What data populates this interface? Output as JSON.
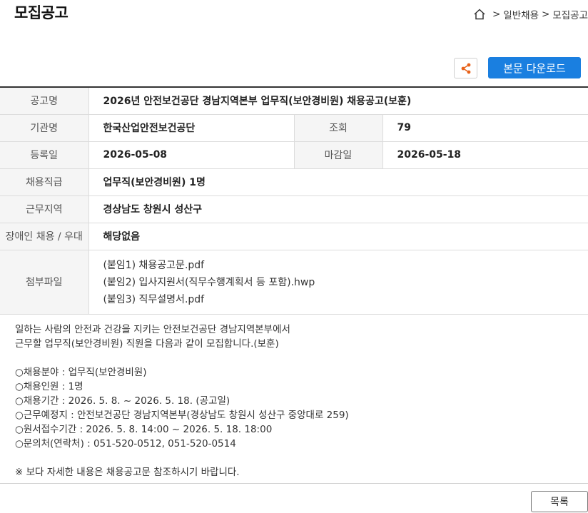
{
  "header": {
    "title": "모집공고",
    "breadcrumb": [
      ">",
      "일반채용",
      ">",
      "모집공고"
    ]
  },
  "toolbar": {
    "share_icon": "share-icon",
    "download_label": "본문 다운로드"
  },
  "info": {
    "rows": {
      "title": {
        "label": "공고명",
        "value": "2026년 안전보건공단 경남지역본부 업무직(보안경비원) 채용공고(보훈)"
      },
      "org": {
        "label": "기관명",
        "value": "한국산업안전보건공단"
      },
      "views": {
        "label": "조회",
        "value": "79"
      },
      "reg_date": {
        "label": "등록일",
        "value": "2026-05-08"
      },
      "deadline": {
        "label": "마감일",
        "value": "2026-05-18"
      },
      "position": {
        "label": "채용직급",
        "value": "업무직(보안경비원) 1명"
      },
      "region": {
        "label": "근무지역",
        "value": "경상남도 창원시 성산구"
      },
      "disability": {
        "label": "장애인 채용 / 우대",
        "value": "해당없음"
      },
      "attachments": {
        "label": "첨부파일",
        "files": [
          "(붙임1) 채용공고문.pdf",
          "(붙임2) 입사지원서(직무수행계획서 등 포함).hwp",
          "(붙임3) 직무설명서.pdf"
        ]
      }
    }
  },
  "content": {
    "intro": [
      "일하는 사람의 안전과 건강을 지키는 안전보건공단 경남지역본부에서",
      "근무할 업무직(보안경비원) 직원을 다음과 같이 모집합니다.(보훈)"
    ],
    "items": [
      "○채용분야 : 업무직(보안경비원)",
      "○채용인원 : 1명",
      "○채용기간 : 2026. 5. 8. ~ 2026. 5. 18. (공고일)",
      "○근무예정지 :  안전보건공단 경남지역본부(경상남도 창원시 성산구 중앙대로 259)",
      "○원서접수기간 : 2026. 5. 8. 14:00 ~ 2026. 5. 18. 18:00",
      "○문의처(연락처) : 051-520-0512, 051-520-0514"
    ],
    "note": "※ 보다 자세한 내용은 채용공고문 참조하시기 바랍니다."
  },
  "footer": {
    "list_label": "목록"
  },
  "colors": {
    "accent": "#1a7fe0",
    "label_bg": "#f5f5f5",
    "border": "#dcdcdc"
  }
}
